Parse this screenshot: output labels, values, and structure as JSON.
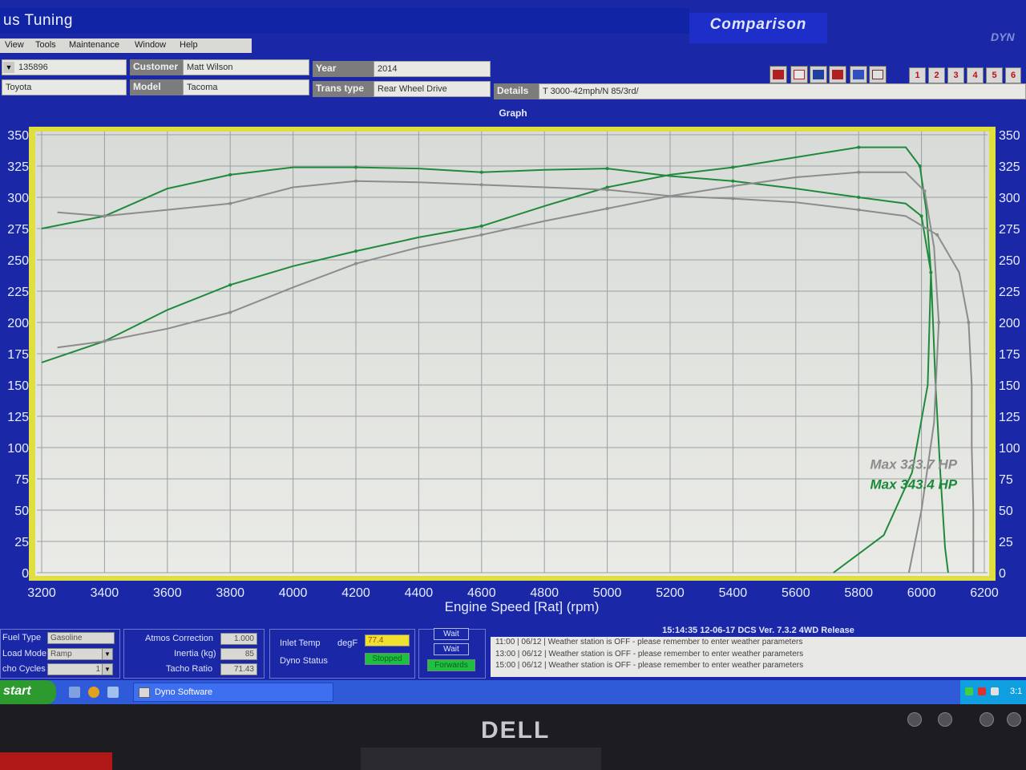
{
  "window": {
    "app_title": "us Tuning",
    "comparison_title": "Comparison",
    "brand_tag": "DYN"
  },
  "menu": [
    "View",
    "Tools",
    "Maintenance",
    "Window",
    "Help"
  ],
  "info": {
    "id": "135896",
    "make": "Toyota",
    "customer_label": "Customer",
    "customer": "Matt Wilson",
    "model_label": "Model",
    "model": "Tacoma",
    "year_label": "Year",
    "year": "2014",
    "trans_label": "Trans type",
    "trans": "Rear Wheel Drive",
    "details_label": "Details",
    "details": "T 3000-42mph/N 85/3rd/"
  },
  "toolbar": {
    "icons": [
      "dyno-graph-icon",
      "curve-icon",
      "bar-chart-icon",
      "gauge-icon",
      "table-icon",
      "list-icon"
    ],
    "numbers": [
      "1",
      "2",
      "3",
      "4",
      "5",
      "6"
    ]
  },
  "graph_label": "Graph",
  "chart_data": {
    "type": "line",
    "xlabel": "Engine Speed [Rat] (rpm)",
    "xlim": [
      3200,
      6200
    ],
    "ylim": [
      0,
      350
    ],
    "x_ticks": [
      "3200",
      "3400",
      "3600",
      "3800",
      "4000",
      "4200",
      "4400",
      "4600",
      "4800",
      "5000",
      "5200",
      "5400",
      "5600",
      "5800",
      "6000",
      "6200"
    ],
    "y_ticks_left": [
      "0",
      "25",
      "50",
      "75",
      "100",
      "125",
      "150",
      "175",
      "200",
      "225",
      "250",
      "275",
      "300",
      "325",
      "350"
    ],
    "y_ticks_right": [
      "0",
      "25",
      "50",
      "75",
      "100",
      "125",
      "150",
      "175",
      "200",
      "225",
      "250",
      "275",
      "300",
      "325",
      "350"
    ],
    "grid": true,
    "annotations": [
      {
        "text": "Max 323.7 HP",
        "color": "#8c8c8c",
        "x": 5975,
        "y": 83
      },
      {
        "text": "Max 343.4 HP",
        "color": "#1a8a3a",
        "x": 5975,
        "y": 67
      }
    ],
    "series": [
      {
        "color": "#1f8a3c",
        "points": [
          [
            3200,
            275
          ],
          [
            3400,
            285
          ],
          [
            3600,
            307
          ],
          [
            3800,
            318
          ],
          [
            4000,
            324
          ],
          [
            4200,
            324
          ],
          [
            4400,
            323
          ],
          [
            4600,
            320
          ],
          [
            4800,
            322
          ],
          [
            5000,
            323
          ],
          [
            5200,
            317
          ],
          [
            5400,
            313
          ],
          [
            5600,
            307
          ],
          [
            5800,
            300
          ],
          [
            5950,
            295
          ],
          [
            6000,
            285
          ],
          [
            6030,
            240
          ],
          [
            6045,
            150
          ],
          [
            6060,
            80
          ],
          [
            6075,
            20
          ],
          [
            6085,
            0
          ]
        ]
      },
      {
        "color": "#1f8a3c",
        "points": [
          [
            3200,
            168
          ],
          [
            3400,
            185
          ],
          [
            3600,
            210
          ],
          [
            3800,
            230
          ],
          [
            4000,
            245
          ],
          [
            4200,
            257
          ],
          [
            4400,
            268
          ],
          [
            4600,
            277
          ],
          [
            4800,
            293
          ],
          [
            5000,
            308
          ],
          [
            5200,
            318
          ],
          [
            5400,
            324
          ],
          [
            5600,
            332
          ],
          [
            5800,
            340
          ],
          [
            5950,
            340
          ],
          [
            5995,
            325
          ],
          [
            6015,
            290
          ],
          [
            6030,
            240
          ],
          [
            6020,
            150
          ],
          [
            5970,
            80
          ],
          [
            5880,
            30
          ],
          [
            5720,
            0
          ]
        ]
      },
      {
        "color": "#8c8c8c",
        "points": [
          [
            3250,
            288
          ],
          [
            3400,
            285
          ],
          [
            3600,
            290
          ],
          [
            3800,
            295
          ],
          [
            4000,
            308
          ],
          [
            4200,
            313
          ],
          [
            4400,
            312
          ],
          [
            4600,
            310
          ],
          [
            4800,
            308
          ],
          [
            5000,
            306
          ],
          [
            5200,
            301
          ],
          [
            5400,
            299
          ],
          [
            5600,
            296
          ],
          [
            5800,
            290
          ],
          [
            5950,
            285
          ],
          [
            6050,
            270
          ],
          [
            6120,
            240
          ],
          [
            6150,
            200
          ],
          [
            6160,
            150
          ],
          [
            6160,
            100
          ],
          [
            6165,
            50
          ],
          [
            6165,
            0
          ]
        ]
      },
      {
        "color": "#8c8c8c",
        "points": [
          [
            3250,
            180
          ],
          [
            3400,
            185
          ],
          [
            3600,
            195
          ],
          [
            3800,
            208
          ],
          [
            4000,
            228
          ],
          [
            4200,
            247
          ],
          [
            4400,
            260
          ],
          [
            4600,
            270
          ],
          [
            4800,
            281
          ],
          [
            5000,
            291
          ],
          [
            5200,
            301
          ],
          [
            5400,
            309
          ],
          [
            5600,
            316
          ],
          [
            5800,
            320
          ],
          [
            5950,
            320
          ],
          [
            6010,
            305
          ],
          [
            6040,
            260
          ],
          [
            6055,
            200
          ],
          [
            6040,
            120
          ],
          [
            6000,
            50
          ],
          [
            5960,
            0
          ]
        ]
      }
    ]
  },
  "status": {
    "fuel_type_label": "Fuel Type",
    "fuel_type": "Gasoline",
    "load_mode_label": "Load Mode",
    "load_mode": "Ramp",
    "echo_cycles_label": "cho Cycles",
    "echo_cycles": "1",
    "atmos_label": "Atmos Correction",
    "atmos": "1.000",
    "inertia_label": "Inertia (kg)",
    "inertia": "85",
    "tacho_label": "Tacho Ratio",
    "tacho": "71.43",
    "inlet_temp_label": "Inlet Temp",
    "inlet_unit": "degF",
    "inlet_temp": "77.4",
    "dyno_status_label": "Dyno Status",
    "dyno_status": "Stopped",
    "wait1": "Wait",
    "wait2": "Wait",
    "forwards": "Forwards"
  },
  "log": {
    "header": "15:14:35    12-06-17  DCS Ver. 7.3.2 4WD Release",
    "lines": [
      "11:00 | 06/12 | Weather station is OFF - please remember to enter weather parameters",
      "13:00 | 06/12 | Weather station is OFF - please remember to enter weather parameters",
      "15:00 | 06/12 | Weather station is OFF - please remember to enter weather parameters"
    ]
  },
  "taskbar": {
    "start": "start",
    "task_label": "Dyno Software",
    "clock": "3:1"
  },
  "monitor": {
    "logo": "DELL"
  }
}
